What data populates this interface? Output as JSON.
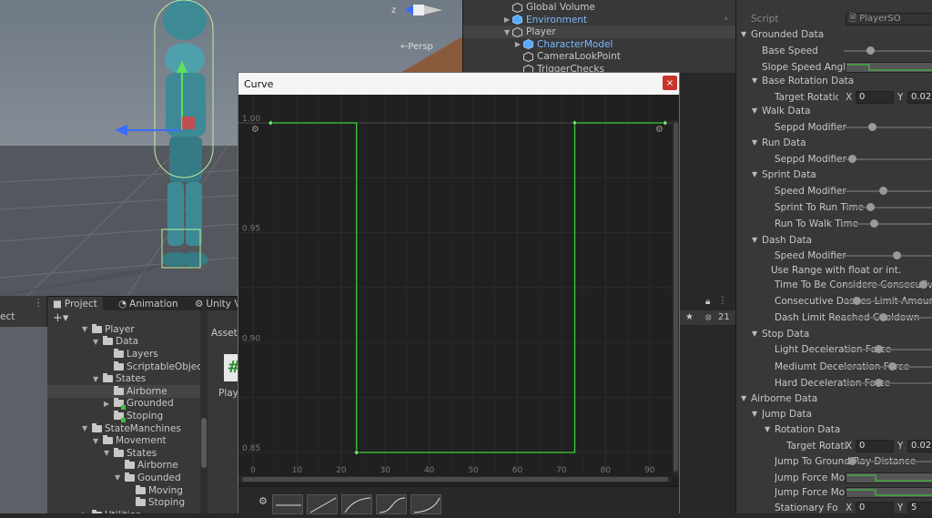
{
  "scene": {
    "axis_z_label": "z",
    "persp_label": "←Persp"
  },
  "hierarchy": {
    "items": [
      {
        "label": "Global Volume",
        "indent": 0,
        "arrow": "",
        "color": "normal"
      },
      {
        "label": "Environment",
        "indent": 0,
        "arrow": "▶",
        "color": "blue"
      },
      {
        "label": "Player",
        "indent": 0,
        "arrow": "▼",
        "color": "normal"
      },
      {
        "label": "CharacterModel",
        "indent": 1,
        "arrow": "▶",
        "color": "blue"
      },
      {
        "label": "CameraLookPoint",
        "indent": 1,
        "arrow": "",
        "color": "normal"
      },
      {
        "label": "TriggerChecks",
        "indent": 1,
        "arrow": "",
        "color": "normal"
      }
    ]
  },
  "inspector": {
    "script_label": "Script",
    "script_value": "PlayerSO",
    "grounded_data": "Grounded Data",
    "base_speed": "Base Speed",
    "slope_speed_angle": "Slope Speed Angle",
    "base_rotation_data": "Base Rotation Data",
    "target_rotation": "Target Rotation",
    "x_label": "X",
    "x_value": "0",
    "y_label": "Y",
    "y_value": "0.02",
    "walk_data": "Walk Data",
    "seppd_modifier": "Seppd Modifier",
    "run_data": "Run Data",
    "seppd_modifier_run": "Seppd Modifier",
    "sprint_data": "Sprint Data",
    "speed_modifier": "Speed Modifier",
    "sprint_to_run_time": "Sprint To Run Time",
    "run_to_walk_time": "Run To Walk Time",
    "dash_data": "Dash Data",
    "dash_speed_modifier": "Speed Modifier",
    "use_range_help": "Use Range with float or int.",
    "time_considered_consecutive": "Time To Be Considere Consecutive",
    "consecutive_dash_limit": "Consecutive Dashes Limit Amount",
    "dash_limit_cooldown": "Dash Limit Reached Cooldown",
    "stop_data": "Stop Data",
    "light_decel": "Light Deceleration Force",
    "medium_decel": "Mediumt Deceleration Force",
    "hard_decel": "Hard Deceleration Force",
    "airborne_data": "Airborne Data",
    "jump_data": "Jump Data",
    "rotation_data": "Rotation Data",
    "target_rotation_short": "Target Rotati",
    "jump_x_value": "0",
    "jump_y_value": "0.02",
    "jump_to_ground_ray": "Jump To Ground Ray Distance",
    "jump_force_mod_1": "Jump Force Mo",
    "jump_force_mod_2": "Jump Force Mo",
    "stationary_force": "Stationary Forc",
    "stationary_x": "0",
    "stationary_y": "5"
  },
  "project": {
    "tab_project": "Project",
    "tab_animation": "Animation",
    "tab_unity": "Unity V",
    "left_strip_label": "ect",
    "assets_label": "Assets",
    "asset_file_label": "Playe",
    "hidden_count": "21",
    "tree": [
      {
        "label": "Player",
        "indent": 0,
        "arrow": "▼",
        "dot": false
      },
      {
        "label": "Data",
        "indent": 1,
        "arrow": "▼",
        "dot": false
      },
      {
        "label": "Layers",
        "indent": 2,
        "arrow": "",
        "dot": false
      },
      {
        "label": "ScriptableObjec",
        "indent": 2,
        "arrow": "",
        "dot": false
      },
      {
        "label": "States",
        "indent": 1,
        "arrow": "▼",
        "dot": false
      },
      {
        "label": "Airborne",
        "indent": 2,
        "arrow": "",
        "dot": false,
        "selected": true
      },
      {
        "label": "Grounded",
        "indent": 2,
        "arrow": "▶",
        "dot": true
      },
      {
        "label": "Stoping",
        "indent": 2,
        "arrow": "",
        "dot": true
      },
      {
        "label": "StateManchines",
        "indent": 0,
        "arrow": "▼",
        "dot": false
      },
      {
        "label": "Movement",
        "indent": 1,
        "arrow": "▼",
        "dot": false
      },
      {
        "label": "States",
        "indent": 2,
        "arrow": "▼",
        "dot": false
      },
      {
        "label": "Airborne",
        "indent": 3,
        "arrow": "",
        "dot": false
      },
      {
        "label": "Gounded",
        "indent": 3,
        "arrow": "▼",
        "dot": false
      },
      {
        "label": "Moving",
        "indent": 4,
        "arrow": "",
        "dot": false
      },
      {
        "label": "Stoping",
        "indent": 4,
        "arrow": "",
        "dot": false
      },
      {
        "label": "Utilities",
        "indent": 0,
        "arrow": "▶",
        "dot": false
      }
    ]
  },
  "curve_window": {
    "title": "Curve",
    "close_glyph": "×"
  },
  "chart_data": {
    "type": "line",
    "title": "",
    "xlabel": "",
    "ylabel": "",
    "xlim": [
      0,
      95
    ],
    "ylim": [
      0.85,
      1.0
    ],
    "x_ticks": [
      0,
      10,
      20,
      30,
      40,
      50,
      60,
      70,
      80,
      90
    ],
    "y_ticks": [
      {
        "value": 1.0,
        "label": "1.00"
      },
      {
        "value": 0.95,
        "label": "0.95"
      },
      {
        "value": 0.9,
        "label": "0.90"
      },
      {
        "value": 0.85,
        "label": "0.85"
      }
    ],
    "series": [
      {
        "color": "#3ad43a",
        "points": [
          [
            4,
            1.0
          ],
          [
            23.5,
            1.0
          ],
          [
            23.5,
            0.85
          ],
          [
            73,
            0.85
          ],
          [
            73,
            1.0
          ],
          [
            93.5,
            1.0
          ]
        ]
      }
    ],
    "keyframes": [
      [
        4,
        1.0
      ],
      [
        23.5,
        0.85
      ],
      [
        73,
        1.0
      ],
      [
        93.5,
        1.0
      ]
    ]
  }
}
